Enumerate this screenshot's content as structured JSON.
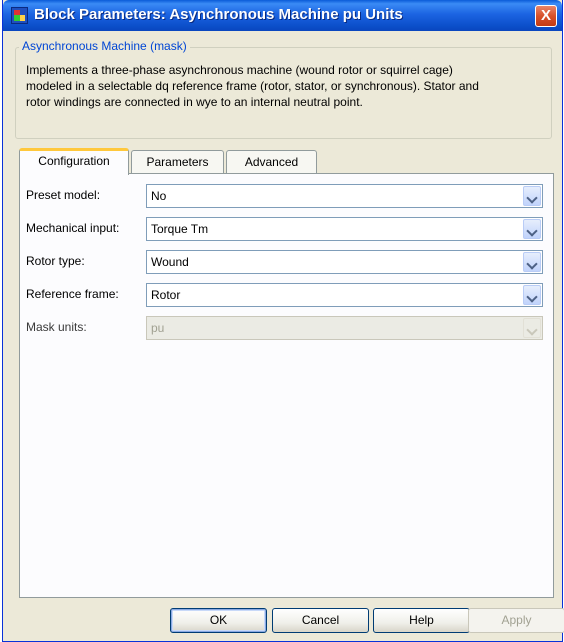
{
  "window": {
    "title": "Block Parameters: Asynchronous Machine pu Units",
    "close_glyph": "X",
    "colors": {
      "titlebar": "#0B4EC9",
      "window_bg": "#ECE9D8",
      "legend_text": "#0046D5",
      "tab_highlight": "#FFC83C"
    }
  },
  "mask_group": {
    "legend": "Asynchronous Machine (mask)",
    "description_lines": [
      "Implements a three-phase asynchronous machine (wound rotor or squirrel cage)",
      "modeled in a selectable dq reference frame (rotor, stator, or synchronous). Stator and",
      "rotor windings are connected in wye to an internal neutral point."
    ]
  },
  "tabs": [
    {
      "label": "Configuration",
      "active": true
    },
    {
      "label": "Parameters",
      "active": false
    },
    {
      "label": "Advanced",
      "active": false
    }
  ],
  "configuration": {
    "fields": [
      {
        "label": "Preset model:",
        "value": "No",
        "enabled": true
      },
      {
        "label": "Mechanical input:",
        "value": "Torque Tm",
        "enabled": true
      },
      {
        "label": "Rotor type:",
        "value": "Wound",
        "enabled": true
      },
      {
        "label": "Reference frame:",
        "value": "Rotor",
        "enabled": true
      },
      {
        "label": "Mask units:",
        "value": "pu",
        "enabled": false
      }
    ]
  },
  "buttons": {
    "ok": "OK",
    "cancel": "Cancel",
    "help": "Help",
    "apply": "Apply"
  }
}
